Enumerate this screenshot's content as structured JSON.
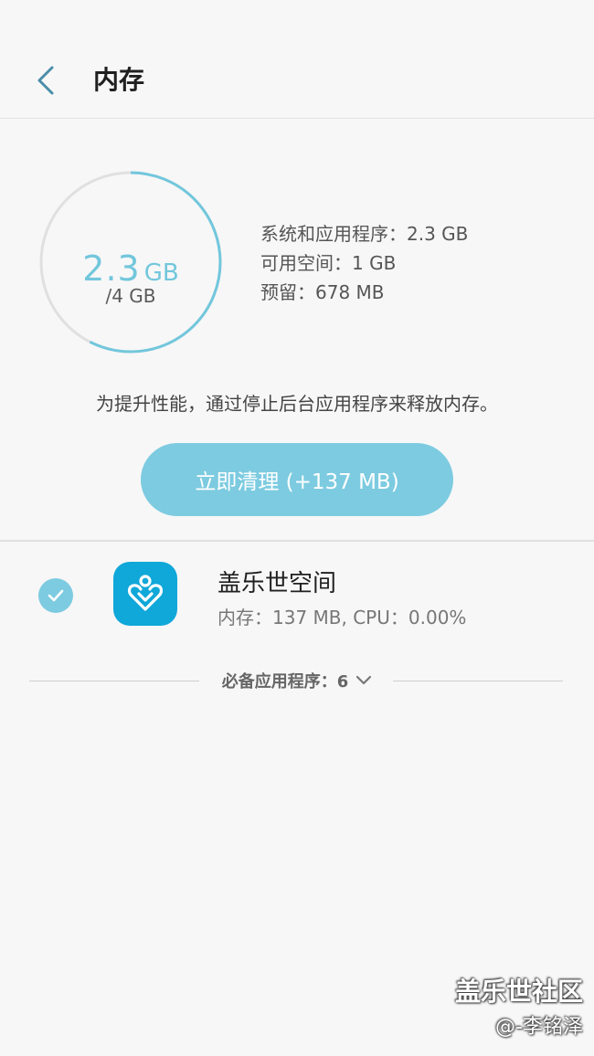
{
  "header": {
    "title": "内存",
    "back_icon": "chevron-left-icon"
  },
  "memory": {
    "used_value": "2.3",
    "used_unit": "GB",
    "total_label": "/4 GB",
    "used_fraction": 0.575,
    "ring_color": "#72c7dc",
    "ring_track_color": "#e0e0e0",
    "info": {
      "system_apps": "系统和应用程序：2.3 GB",
      "available": "可用空间：1 GB",
      "reserved": "预留：678 MB"
    }
  },
  "hint": "为提升性能，通过停止后台应用程序来释放内存。",
  "clean_button": {
    "label": "立即清理 (+137 MB)",
    "color": "#7dcbe0"
  },
  "apps": [
    {
      "name": "盖乐世空间",
      "detail": "内存：137 MB, CPU：0.00%",
      "checked": true,
      "icon": "galaxy-space-app-icon",
      "icon_color": "#10a7d9"
    }
  ],
  "essential": {
    "label": "必备应用程序：6",
    "icon": "chevron-down-icon"
  },
  "watermark": {
    "line1": "盖乐世社区",
    "line2": "@-李铭泽"
  }
}
